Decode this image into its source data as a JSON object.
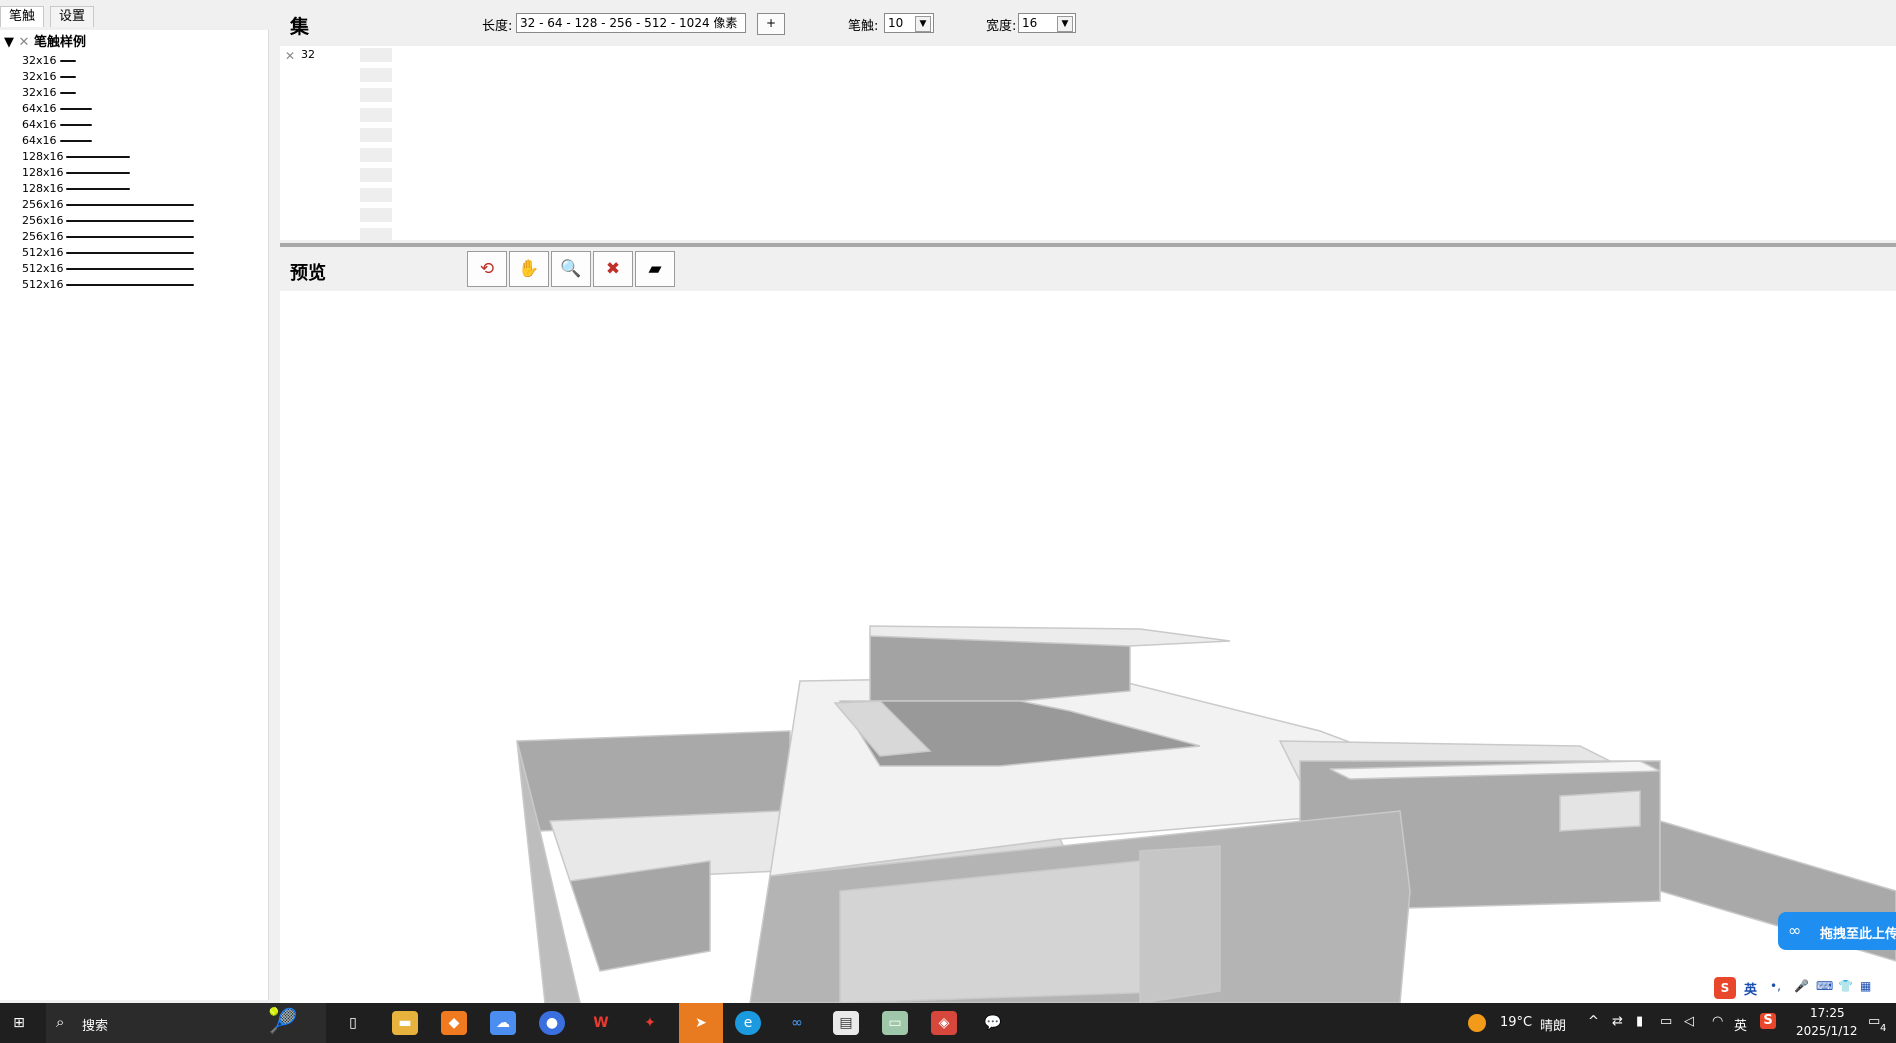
{
  "left_panel": {
    "tabs": [
      "笔触",
      "设置"
    ],
    "tree_root": "笔触样例",
    "items": [
      {
        "label": "32x16",
        "length": 32
      },
      {
        "label": "32x16",
        "length": 32
      },
      {
        "label": "32x16",
        "length": 32
      },
      {
        "label": "64x16",
        "length": 64
      },
      {
        "label": "64x16",
        "length": 64
      },
      {
        "label": "64x16",
        "length": 64
      },
      {
        "label": "128x16",
        "length": 128
      },
      {
        "label": "128x16",
        "length": 128
      },
      {
        "label": "128x16",
        "length": 128
      },
      {
        "label": "256x16",
        "length": 256
      },
      {
        "label": "256x16",
        "length": 256
      },
      {
        "label": "256x16",
        "length": 256
      },
      {
        "label": "512x16",
        "length": 512
      },
      {
        "label": "512x16",
        "length": 512
      },
      {
        "label": "512x16",
        "length": 512
      }
    ]
  },
  "set_panel": {
    "title": "集",
    "length_label": "长度:",
    "length_value": "32 - 64 - 128 - 256 - 512 - 1024 像素",
    "add_button": "+",
    "stroke_label": "笔触:",
    "stroke_value": "10",
    "width_label": "宽度:",
    "width_value": "16",
    "row_label": "32"
  },
  "preview": {
    "title": "预览",
    "tools": [
      "orbit-icon",
      "pan-icon",
      "zoom-icon",
      "zoom-extents-icon",
      "eraser-icon"
    ]
  },
  "overlays": {
    "baidu_upload": "拖拽至此上传"
  },
  "ime": {
    "lang": "英"
  },
  "taskbar": {
    "search_text": "搜索",
    "weather_temp": "19°C",
    "weather_desc": "晴朗",
    "lang": "英",
    "time": "17:25",
    "date": "2025/1/12",
    "notification_count": "4",
    "apps": [
      "task-view-icon",
      "file-explorer-icon",
      "app-orange-icon",
      "app-cloud-icon",
      "app-blue-circle-icon",
      "wps-icon",
      "app-red-icon",
      "app-blue-icon",
      "edge-icon",
      "baidu-netdisk-icon",
      "notepad-icon",
      "app-green-icon",
      "sketchup-icon",
      "wechat-icon"
    ]
  }
}
